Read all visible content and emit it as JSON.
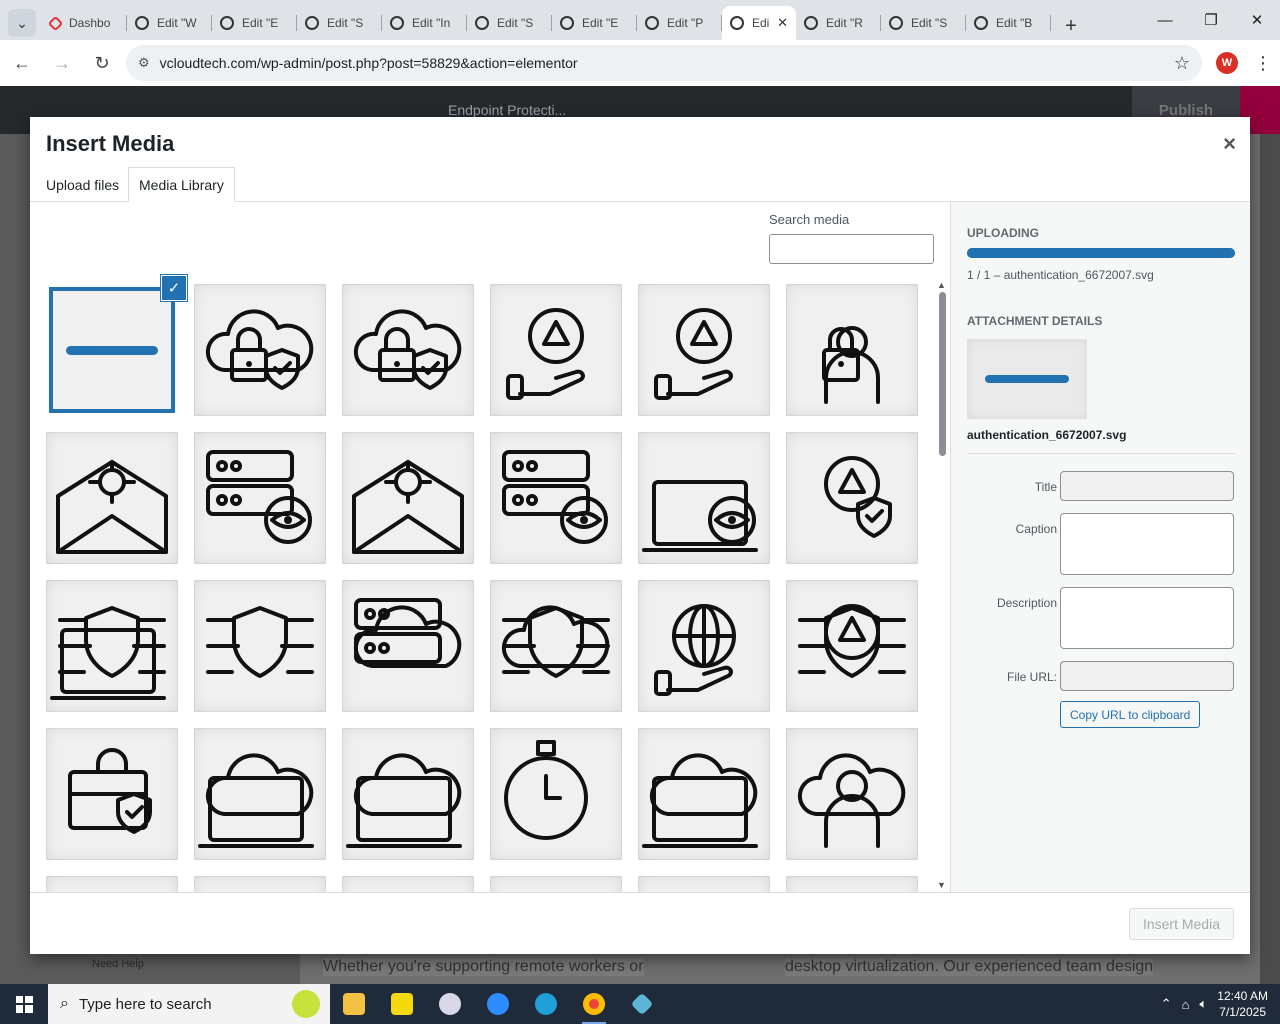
{
  "browser": {
    "tabs": [
      {
        "label": "Dashbo",
        "icon": "wordpress-red-icon"
      },
      {
        "label": "Edit \"W",
        "icon": "wordpress-icon"
      },
      {
        "label": "Edit \"E",
        "icon": "wordpress-icon"
      },
      {
        "label": "Edit \"S",
        "icon": "wordpress-icon"
      },
      {
        "label": "Edit \"In",
        "icon": "wordpress-icon"
      },
      {
        "label": "Edit \"S",
        "icon": "wordpress-icon"
      },
      {
        "label": "Edit \"E",
        "icon": "wordpress-icon"
      },
      {
        "label": "Edit \"P",
        "icon": "wordpress-icon"
      },
      {
        "label": "Edi",
        "icon": "wordpress-icon",
        "active": true
      },
      {
        "label": "Edit \"R",
        "icon": "wordpress-icon"
      },
      {
        "label": "Edit \"S",
        "icon": "wordpress-icon"
      },
      {
        "label": "Edit \"B",
        "icon": "wordpress-icon"
      }
    ],
    "url": "vcloudtech.com/wp-admin/post.php?post=58829&action=elementor",
    "profile_initial": "W"
  },
  "editor": {
    "document_title": "Endpoint Protecti...",
    "publish_label": "Publish",
    "canvas_text_left": "Whether you're supporting remote workers or",
    "canvas_text_right": "desktop virtualization. Our experienced team design",
    "need_help": "Need Help"
  },
  "modal": {
    "title": "Insert Media",
    "close_glyph": "×",
    "tabs": [
      "Upload files",
      "Media Library"
    ],
    "active_tab": "Media Library",
    "search_label": "Search media",
    "search_value": "",
    "grid_icons": [
      "placeholder-bar-icon",
      "cloud-lock-shield-icon",
      "cloud-lock-shield-icon",
      "gear-warning-hand-icon",
      "gear-warning-hand-icon",
      "person-lock-board-icon",
      "email-bug-icon",
      "server-eye-icon",
      "email-bug-icon",
      "server-eye-icon",
      "laptop-eye-timer-icon",
      "house-gear-shield-icon",
      "wifi-robot-arm-icon",
      "circuit-shield-icon",
      "cloud-server-shield-icon",
      "cloud-network-icon",
      "globe-hand-tools-icon",
      "gear-circuit-warning-icon",
      "briefcase-shield-icon",
      "shield-cloud-laptop-icon",
      "cloud-devices-icon",
      "stopwatch-dollar-icon",
      "cloud-laptop-chart-icon",
      "person-cloud-gear-icon"
    ],
    "selected_index": 0,
    "sidebar": {
      "uploading_heading": "UPLOADING",
      "upload_progress": 1.0,
      "upload_status": "1 / 1  –  authentication_6672007.svg",
      "details_heading": "ATTACHMENT DETAILS",
      "filename": "authentication_6672007.svg",
      "fields": [
        {
          "label": "Title",
          "value": ""
        },
        {
          "label": "Caption",
          "value": ""
        },
        {
          "label": "Description",
          "value": ""
        },
        {
          "label": "File URL:",
          "value": ""
        }
      ],
      "copy_button": "Copy URL to clipboard"
    },
    "insert_button": "Insert Media",
    "accent_color": "#2271b1"
  },
  "taskbar": {
    "search_placeholder": "Type here to search",
    "time": "12:40 AM",
    "date": "7/1/2025"
  }
}
